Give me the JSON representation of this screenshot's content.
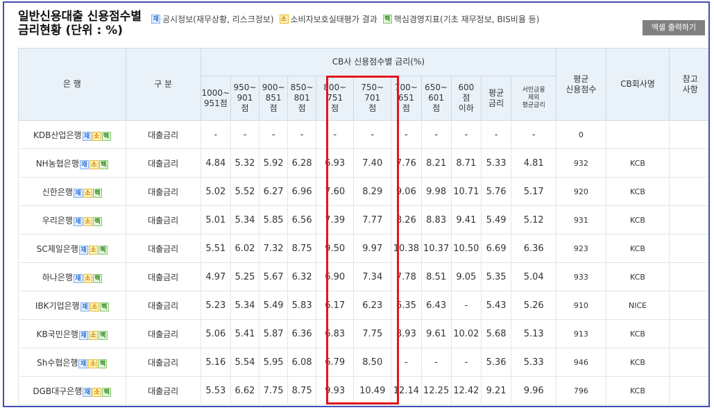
{
  "title": {
    "line1": "일반신용대출 신용점수별",
    "line2": "금리현황 (단위 : %)"
  },
  "legend": [
    {
      "badge": "재",
      "text": "공시정보(재무상황, 리스크정보)"
    },
    {
      "badge": "소",
      "text": "소비자보호실태평가 결과"
    },
    {
      "badge": "핵",
      "text": "핵심경영지표(기초 재무정보, BIS비율 등)"
    }
  ],
  "excel_button": "엑셀 출력하기",
  "headers": {
    "bank": "은 행",
    "gubun": "구 분",
    "group": "CB사 신용점수별 금리(%)",
    "bands": [
      "1000~\n951점",
      "950~\n901\n점",
      "900~\n851\n점",
      "850~\n801\n점",
      "800~\n751\n점",
      "750~\n701\n점",
      "700~\n651\n점",
      "650~\n601\n점",
      "600\n점\n이하",
      "평균\n금리",
      "서민금융\n제외\n평균금리"
    ],
    "avg_score": "평균\n신용점수",
    "cb": "CB회사명",
    "note": "참고\n사항"
  },
  "badges": {
    "j": "재",
    "s": "소",
    "h": "핵"
  },
  "rows": [
    {
      "bank": "KDB산업은행",
      "gubun": "대출금리",
      "rates": [
        "-",
        "-",
        "-",
        "-",
        "-",
        "-",
        "-",
        "-",
        "-",
        "-",
        "-"
      ],
      "score": "0",
      "cb": ""
    },
    {
      "bank": "NH농협은행",
      "gubun": "대출금리",
      "rates": [
        "4.84",
        "5.32",
        "5.92",
        "6.28",
        "6.93",
        "7.40",
        "7.76",
        "8.21",
        "8.71",
        "5.33",
        "4.81"
      ],
      "score": "932",
      "cb": "KCB"
    },
    {
      "bank": "신한은행",
      "gubun": "대출금리",
      "rates": [
        "5.02",
        "5.52",
        "6.27",
        "6.96",
        "7.60",
        "8.29",
        "9.06",
        "9.98",
        "10.71",
        "5.76",
        "5.17"
      ],
      "score": "920",
      "cb": "KCB"
    },
    {
      "bank": "우리은행",
      "gubun": "대출금리",
      "rates": [
        "5.01",
        "5.34",
        "5.85",
        "6.56",
        "7.39",
        "7.77",
        "8.26",
        "8.83",
        "9.41",
        "5.49",
        "5.12"
      ],
      "score": "931",
      "cb": "KCB"
    },
    {
      "bank": "SC제일은행",
      "gubun": "대출금리",
      "rates": [
        "5.51",
        "6.02",
        "7.32",
        "8.75",
        "9.50",
        "9.97",
        "10.38",
        "10.37",
        "10.50",
        "6.69",
        "6.36"
      ],
      "score": "923",
      "cb": "KCB"
    },
    {
      "bank": "하나은행",
      "gubun": "대출금리",
      "rates": [
        "4.97",
        "5.25",
        "5.67",
        "6.32",
        "6.90",
        "7.34",
        "7.78",
        "8.51",
        "9.05",
        "5.35",
        "5.04"
      ],
      "score": "933",
      "cb": "KCB"
    },
    {
      "bank": "IBK기업은행",
      "gubun": "대출금리",
      "rates": [
        "5.23",
        "5.34",
        "5.49",
        "5.83",
        "6.17",
        "6.23",
        "6.35",
        "6.43",
        "-",
        "5.43",
        "5.26"
      ],
      "score": "910",
      "cb": "NICE"
    },
    {
      "bank": "KB국민은행",
      "gubun": "대출금리",
      "rates": [
        "5.06",
        "5.41",
        "5.87",
        "6.36",
        "6.83",
        "7.75",
        "8.93",
        "9.61",
        "10.02",
        "5.68",
        "5.13"
      ],
      "score": "913",
      "cb": "KCB"
    },
    {
      "bank": "Sh수협은행",
      "gubun": "대출금리",
      "rates": [
        "5.16",
        "5.54",
        "5.95",
        "6.08",
        "6.79",
        "8.50",
        "-",
        "-",
        "-",
        "5.36",
        "5.33"
      ],
      "score": "946",
      "cb": "KCB"
    },
    {
      "bank": "DGB대구은행",
      "gubun": "대출금리",
      "rates": [
        "5.53",
        "6.62",
        "7.75",
        "8.75",
        "9.93",
        "10.49",
        "12.14",
        "12.25",
        "12.42",
        "9.21",
        "9.96"
      ],
      "score": "796",
      "cb": "KCB"
    }
  ],
  "colors": {
    "highlight": "#e4141b",
    "frame": "#3f4fb3",
    "header_bg": "#eaf2f9",
    "button_bg": "#808080"
  }
}
